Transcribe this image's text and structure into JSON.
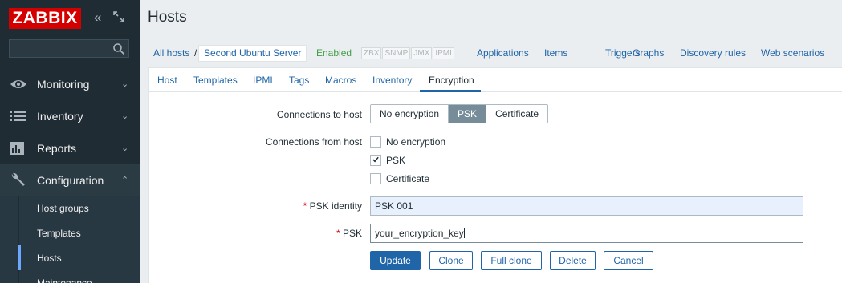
{
  "sidebar": {
    "logo": "ZABBIX",
    "collapse_glyph": "«",
    "search_placeholder": "",
    "menu": [
      {
        "label": "Monitoring",
        "icon": "eye-icon"
      },
      {
        "label": "Inventory",
        "icon": "list-icon"
      },
      {
        "label": "Reports",
        "icon": "bar-chart-icon"
      },
      {
        "label": "Configuration",
        "icon": "wrench-icon"
      }
    ],
    "submenu": [
      "Host groups",
      "Templates",
      "Hosts",
      "Maintenance"
    ],
    "chevron_down": "⌄",
    "chevron_up": "⌃"
  },
  "page": {
    "title": "Hosts"
  },
  "host_nav": {
    "all_hosts": "All hosts",
    "separator": "/",
    "current_host": "Second Ubuntu Server",
    "status": "Enabled",
    "availability": [
      "ZBX",
      "SNMP",
      "JMX",
      "IPMI"
    ],
    "links": [
      "Applications",
      "Items",
      "Triggers",
      "Graphs",
      "Discovery rules",
      "Web scenarios"
    ]
  },
  "tabs": [
    "Host",
    "Templates",
    "IPMI",
    "Tags",
    "Macros",
    "Inventory",
    "Encryption"
  ],
  "form": {
    "connections_to_host_label": "Connections to host",
    "connections_to_host_options": [
      "No encryption",
      "PSK",
      "Certificate"
    ],
    "connections_to_host_selected": "PSK",
    "connections_from_host_label": "Connections from host",
    "from_no_encryption": "No encryption",
    "from_psk": "PSK",
    "from_certificate": "Certificate",
    "psk_identity_label": "PSK identity",
    "psk_identity_value": "PSK 001",
    "psk_label": "PSK",
    "psk_value": "your_encryption_key",
    "required_mark": "*"
  },
  "buttons": {
    "update": "Update",
    "clone": "Clone",
    "full_clone": "Full clone",
    "delete": "Delete",
    "cancel": "Cancel"
  },
  "colors": {
    "sidebar_bg": "#1f2c33",
    "logo_red": "#d40000",
    "link_blue": "#1f65a8",
    "enabled_green": "#429e47"
  }
}
